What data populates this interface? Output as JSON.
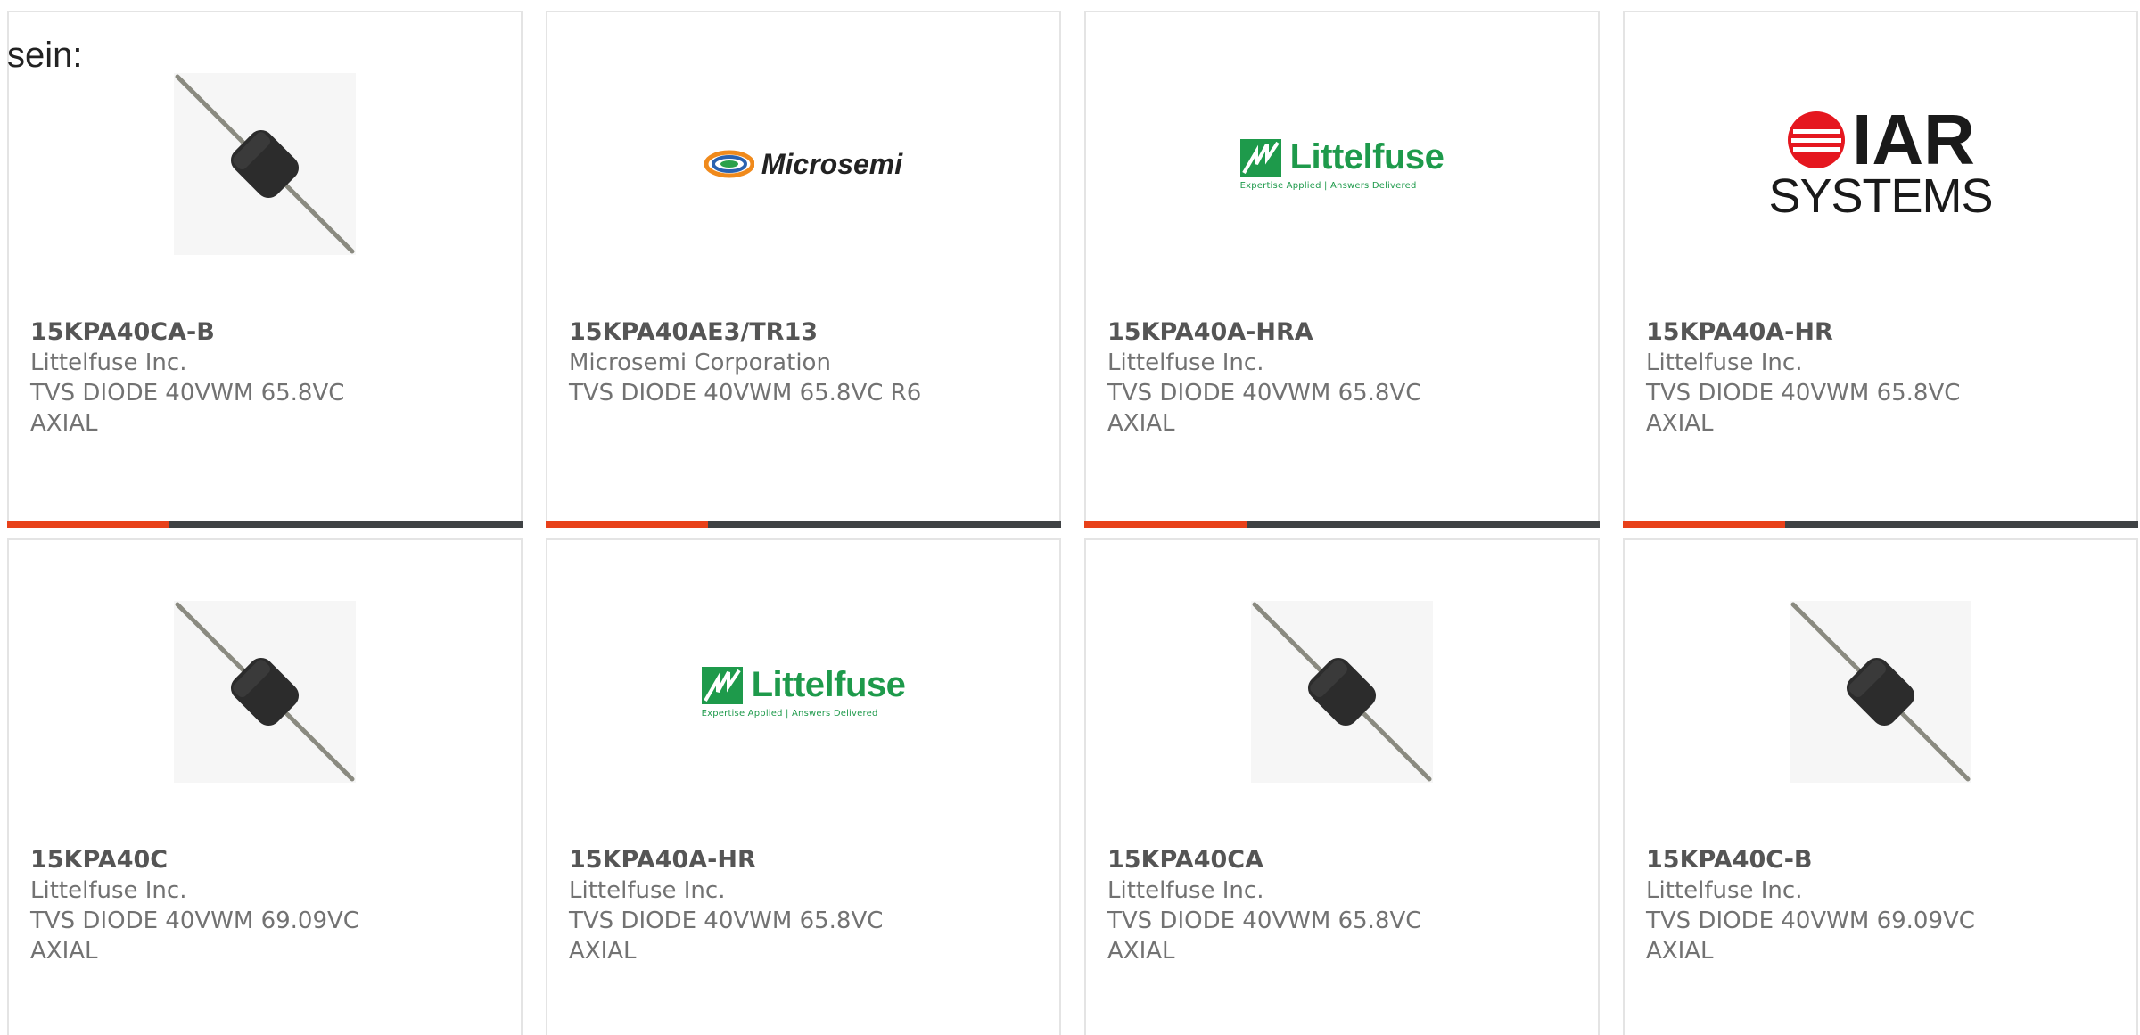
{
  "lead_text": "sein:",
  "colors": {
    "accent": "#e8411a",
    "bar": "#3f4244",
    "littelfuse_green": "#1e9a4b",
    "iar_red": "#e5171f"
  },
  "cards": [
    {
      "part_number": "15KPA40CA-B",
      "manufacturer": "Littelfuse Inc.",
      "description": "TVS DIODE 40VWM 65.8VC AXIAL",
      "image": "axial-diode-image"
    },
    {
      "part_number": "15KPA40AE3/TR13",
      "manufacturer": "Microsemi Corporation",
      "description": "TVS DIODE 40VWM 65.8VC R6",
      "image": "microsemi-logo",
      "logo_text": "Microsemi"
    },
    {
      "part_number": "15KPA40A-HRA",
      "manufacturer": "Littelfuse Inc.",
      "description": "TVS DIODE 40VWM 65.8VC AXIAL",
      "image": "littelfuse-logo",
      "logo_text": "Littelfuse",
      "logo_tagline": "Expertise Applied | Answers Delivered"
    },
    {
      "part_number": "15KPA40A-HR",
      "manufacturer": "Littelfuse Inc.",
      "description": "TVS DIODE 40VWM 65.8VC AXIAL",
      "image": "iar-systems-logo",
      "logo_text": "IAR",
      "logo_subtext": "SYSTEMS"
    },
    {
      "part_number": "15KPA40C",
      "manufacturer": "Littelfuse Inc.",
      "description": "TVS DIODE 40VWM 69.09VC AXIAL",
      "image": "axial-diode-image"
    },
    {
      "part_number": "15KPA40A-HR",
      "manufacturer": "Littelfuse Inc.",
      "description": "TVS DIODE 40VWM 65.8VC AXIAL",
      "image": "littelfuse-logo",
      "logo_text": "Littelfuse",
      "logo_tagline": "Expertise Applied | Answers Delivered"
    },
    {
      "part_number": "15KPA40CA",
      "manufacturer": "Littelfuse Inc.",
      "description": "TVS DIODE 40VWM 65.8VC AXIAL",
      "image": "axial-diode-image"
    },
    {
      "part_number": "15KPA40C-B",
      "manufacturer": "Littelfuse Inc.",
      "description": "TVS DIODE 40VWM 69.09VC AXIAL",
      "image": "axial-diode-image"
    }
  ]
}
